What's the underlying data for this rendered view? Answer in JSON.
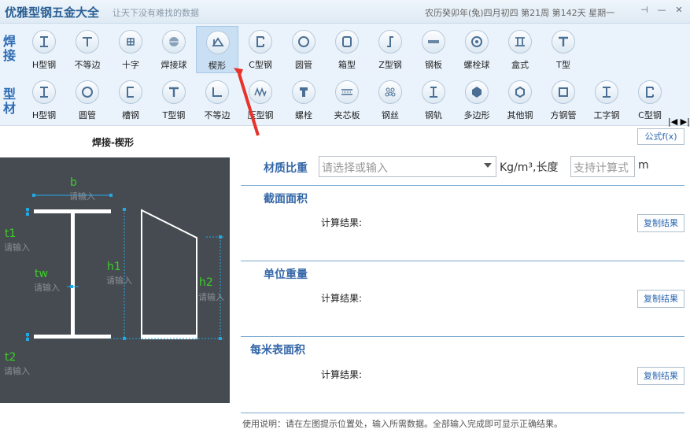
{
  "window": {
    "title": "优雅型钢五金大全",
    "slogan": "让天下没有难找的数据",
    "date": "农历癸卯年(兔)四月初四 第21周 第142天 星期一",
    "pin": "⊣",
    "minimize": "—",
    "close": "✕"
  },
  "toolbar": {
    "row1_label": "焊接",
    "row2_label": "型材",
    "row1": [
      {
        "label": "H型钢",
        "icon": "h-beam-icon"
      },
      {
        "label": "不等边",
        "icon": "t-shape-icon"
      },
      {
        "label": "十字",
        "icon": "cross-icon"
      },
      {
        "label": "焊接球",
        "icon": "sphere-icon"
      },
      {
        "label": "楔形",
        "icon": "wedge-icon"
      },
      {
        "label": "C型钢",
        "icon": "c-channel-icon"
      },
      {
        "label": "圆管",
        "icon": "round-tube-icon"
      },
      {
        "label": "箱型",
        "icon": "box-icon"
      },
      {
        "label": "Z型钢",
        "icon": "z-section-icon"
      },
      {
        "label": "钢板",
        "icon": "plate-icon"
      },
      {
        "label": "螺栓球",
        "icon": "bolt-ball-icon"
      },
      {
        "label": "盒式",
        "icon": "box-type-icon"
      },
      {
        "label": "T型",
        "icon": "t-section-icon"
      }
    ],
    "row2": [
      {
        "label": "H型钢",
        "icon": "h-beam-icon"
      },
      {
        "label": "圆管",
        "icon": "round-tube-icon"
      },
      {
        "label": "槽钢",
        "icon": "channel-icon"
      },
      {
        "label": "T型钢",
        "icon": "t-section-icon"
      },
      {
        "label": "不等边",
        "icon": "angle-icon"
      },
      {
        "label": "压型钢",
        "icon": "corrugated-icon"
      },
      {
        "label": "螺栓",
        "icon": "bolt-icon"
      },
      {
        "label": "夹芯板",
        "icon": "sandwich-panel-icon"
      },
      {
        "label": "钢丝",
        "icon": "wire-icon"
      },
      {
        "label": "钢轨",
        "icon": "rail-icon"
      },
      {
        "label": "多边形",
        "icon": "polygon-icon"
      },
      {
        "label": "其他钢",
        "icon": "hexagon-icon"
      },
      {
        "label": "方钢管",
        "icon": "square-tube-icon"
      },
      {
        "label": "工字钢",
        "icon": "i-beam-icon"
      },
      {
        "label": "C型钢",
        "icon": "c-channel-icon"
      }
    ],
    "active": "楔形",
    "scroll_arrows": "|◀ ▶|"
  },
  "formula_button": "公式f(x)",
  "diagram": {
    "title": "焊接-楔形",
    "labels": {
      "b": "b",
      "t1": "t1",
      "tw": "tw",
      "h1": "h1",
      "h2": "h2",
      "t2": "t2"
    },
    "placeholder": "请输入"
  },
  "form": {
    "density_label": "材质比重",
    "density_placeholder": "请选择或输入",
    "unit_text": "Kg/m³,长度",
    "length_placeholder": "支持计算式",
    "length_unit": "m"
  },
  "sections": [
    {
      "title": "截面面积",
      "result_label": "计算结果:",
      "copy": "复制结果"
    },
    {
      "title": "单位重量",
      "result_label": "计算结果:",
      "copy": "复制结果"
    },
    {
      "title": "每米表面积",
      "result_label": "计算结果:",
      "copy": "复制结果"
    }
  ],
  "usage": "使用说明：请在左图提示位置处，输入所需数据。全部输入完成即可显示正确结果。",
  "colors": {
    "accent": "#3467a8",
    "diagram_bg": "#464b51",
    "label_green": "#3bcf28",
    "dimension_blue": "#23a8e6",
    "arrow_red": "#e8332a"
  }
}
